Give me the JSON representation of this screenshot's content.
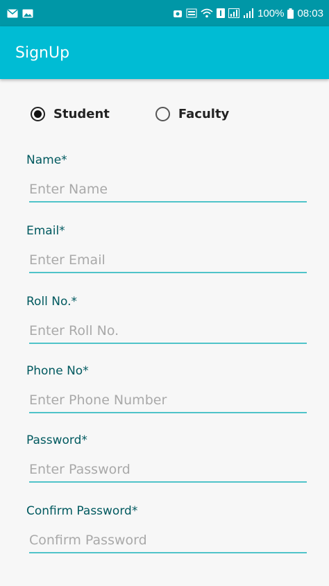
{
  "status_bar": {
    "battery_text": "100%",
    "time": "08:03",
    "color": "#0097a7"
  },
  "app_bar": {
    "title": "SignUp",
    "color": "#00bcd4"
  },
  "role": {
    "options": [
      "Student",
      "Faculty"
    ],
    "selected": "Student"
  },
  "form": {
    "fields": [
      {
        "label": "Name*",
        "placeholder": "Enter Name"
      },
      {
        "label": "Email*",
        "placeholder": "Enter Email"
      },
      {
        "label": "Roll No.*",
        "placeholder": "Enter Roll No."
      },
      {
        "label": "Phone No*",
        "placeholder": "Enter Phone Number"
      },
      {
        "label": "Password*",
        "placeholder": "Enter Password"
      },
      {
        "label": "Confirm Password*",
        "placeholder": "Confirm Password"
      }
    ]
  },
  "accent_underline": "#4fc3c9",
  "label_color": "#00595f"
}
